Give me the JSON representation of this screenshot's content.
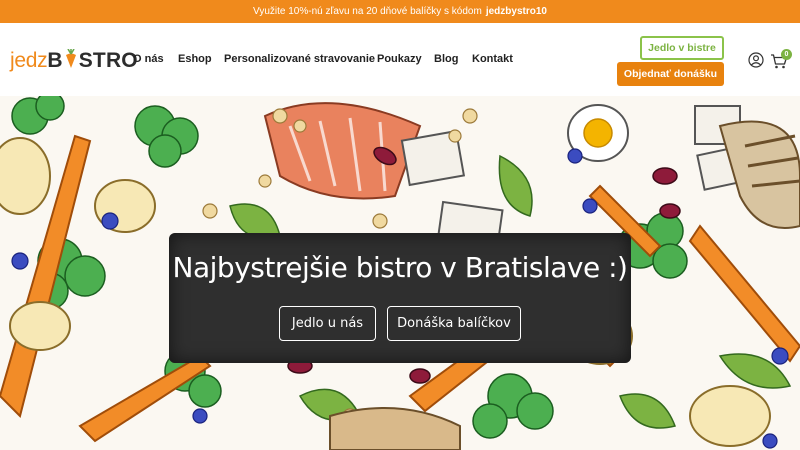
{
  "promo": {
    "text": "Využite 10%-nú zľavu na 20 dňové balíčky s kódom",
    "code": "jedzbystro10"
  },
  "logo": {
    "part_light": "jedz",
    "part_bold_1": "B",
    "part_bold_2": "STRO",
    "icon": "carrot-icon"
  },
  "nav": {
    "items": [
      {
        "label": "O nás"
      },
      {
        "label": "Eshop"
      },
      {
        "label": "Personalizované stravovanie"
      },
      {
        "label": "Poukazy"
      },
      {
        "label": "Blog"
      },
      {
        "label": "Kontakt"
      }
    ]
  },
  "header_actions": {
    "bistro_label": "Jedlo v bistre",
    "order_label": "Objednať donášku",
    "user_icon": "user-icon",
    "cart_icon": "cart-icon",
    "cart_count": "0"
  },
  "hero": {
    "title": "Najbystrejšie bistro v Bratislave :)",
    "btn_eat_label": "Jedlo u nás",
    "btn_delivery_label": "Donáška balíčkov"
  },
  "colors": {
    "brand_orange": "#f08a1c",
    "brand_green": "#8bc34a",
    "chalkboard": "#2f2f2f"
  }
}
